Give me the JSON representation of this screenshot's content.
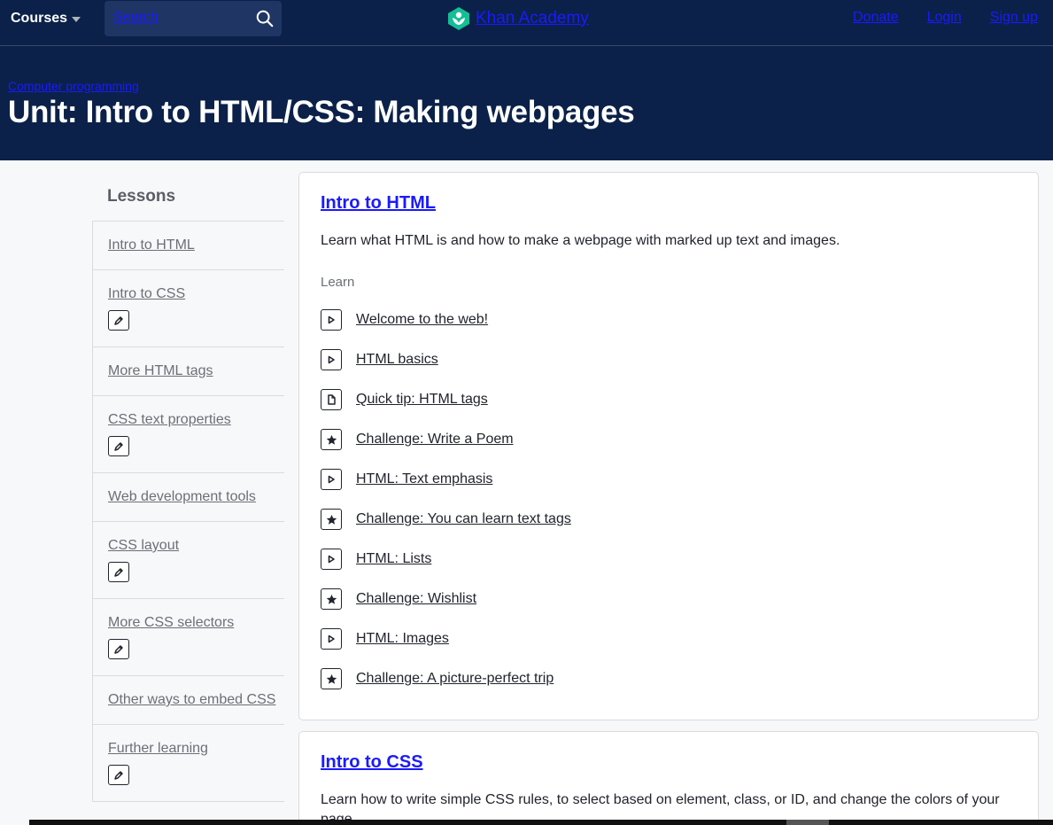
{
  "nav": {
    "courses_label": "Courses",
    "search_text": "Search",
    "brand": "Khan Academy",
    "links": [
      "Donate",
      "Login",
      "Sign up"
    ]
  },
  "header": {
    "breadcrumb": "Computer programming",
    "title": "Unit: Intro to HTML/CSS: Making webpages"
  },
  "sidebar": {
    "heading": "Lessons",
    "items": [
      {
        "label": "Intro to HTML",
        "has_pencil": false
      },
      {
        "label": "Intro to CSS",
        "has_pencil": true
      },
      {
        "label": "More HTML tags",
        "has_pencil": false
      },
      {
        "label": "CSS text properties",
        "has_pencil": true
      },
      {
        "label": "Web development tools",
        "has_pencil": false
      },
      {
        "label": "CSS layout",
        "has_pencil": true
      },
      {
        "label": "More CSS selectors",
        "has_pencil": true
      },
      {
        "label": "Other ways to embed CSS",
        "has_pencil": false
      },
      {
        "label": "Further learning",
        "has_pencil": true
      }
    ]
  },
  "lesson1": {
    "title": "Intro to HTML",
    "description": "Learn what HTML is and how to make a webpage with marked up text and images.",
    "learn_label": "Learn",
    "items": [
      {
        "label": "Welcome to the web!",
        "icon": "play-icon"
      },
      {
        "label": "HTML basics",
        "icon": "play-icon"
      },
      {
        "label": "Quick tip: HTML tags",
        "icon": "article-icon"
      },
      {
        "label": "Challenge: Write a Poem",
        "icon": "star-icon"
      },
      {
        "label": "HTML: Text emphasis",
        "icon": "play-icon"
      },
      {
        "label": "Challenge: You can learn text tags",
        "icon": "star-icon"
      },
      {
        "label": "HTML: Lists",
        "icon": "play-icon"
      },
      {
        "label": "Challenge: Wishlist",
        "icon": "star-icon"
      },
      {
        "label": "HTML: Images",
        "icon": "play-icon"
      },
      {
        "label": "Challenge: A picture-perfect trip",
        "icon": "star-icon"
      }
    ]
  },
  "lesson2": {
    "title": "Intro to CSS",
    "description": "Learn how to write simple CSS rules, to select based on element, class, or ID, and change the colors of your page."
  },
  "colors": {
    "nav_bg": "#0b2149",
    "link_blue": "#1a1aff",
    "brand_green": "#14bf96"
  }
}
